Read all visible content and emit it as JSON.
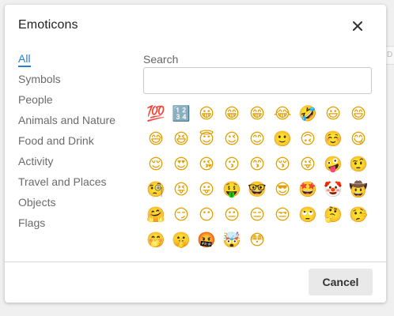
{
  "backdrop": {
    "hint_text": "D"
  },
  "dialog": {
    "title": "Emoticons",
    "close_icon": "close-icon",
    "cancel_label": "Cancel"
  },
  "categories": [
    {
      "label": "All",
      "active": true
    },
    {
      "label": "Symbols",
      "active": false
    },
    {
      "label": "People",
      "active": false
    },
    {
      "label": "Animals and Nature",
      "active": false
    },
    {
      "label": "Food and Drink",
      "active": false
    },
    {
      "label": "Activity",
      "active": false
    },
    {
      "label": "Travel and Places",
      "active": false
    },
    {
      "label": "Objects",
      "active": false
    },
    {
      "label": "Flags",
      "active": false
    }
  ],
  "search": {
    "label": "Search",
    "value": "",
    "placeholder": ""
  },
  "emojis": [
    "💯",
    "🔢",
    "😀",
    "😁",
    "😁",
    "😂",
    "🤣",
    "😃",
    "😄",
    "😅",
    "😆",
    "😇",
    "😉",
    "😊",
    "🙂",
    "🙃",
    "☺️",
    "😋",
    "😌",
    "😍",
    "😘",
    "😗",
    "😙",
    "😚",
    "😜",
    "🤪",
    "🤨",
    "🧐",
    "😝",
    "😛",
    "🤑",
    "🤓",
    "😎",
    "🤩",
    "🤡",
    "🤠",
    "🤗",
    "😏",
    "😶",
    "😐",
    "😑",
    "😒",
    "🙄",
    "🤔",
    "🤥",
    "🤭",
    "🤫",
    "🤬",
    "🤯",
    "😳"
  ],
  "colors": {
    "accent": "#2a7fd4",
    "button_bg": "#e9e9e9"
  }
}
